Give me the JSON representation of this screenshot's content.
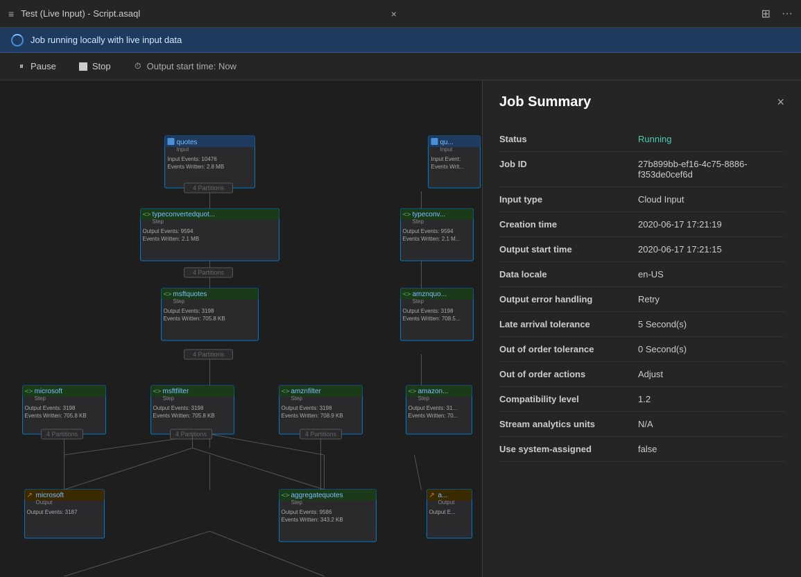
{
  "titleBar": {
    "menuIcon": "≡",
    "title": "Test (Live Input) - Script.asaql",
    "closeIcon": "×",
    "layoutIcon": "⊞",
    "moreIcon": "···"
  },
  "statusBar": {
    "message": "Job running locally with live input data"
  },
  "toolbar": {
    "pauseLabel": "Pause",
    "stopLabel": "Stop",
    "outputStartLabel": "Output start time: Now"
  },
  "jobSummary": {
    "title": "Job Summary",
    "closeIcon": "×",
    "rows": [
      {
        "label": "Status",
        "value": "Running",
        "isStatus": true
      },
      {
        "label": "Job ID",
        "value": "27b899bb-ef16-4c75-8886-f353de0cef6d"
      },
      {
        "label": "Input type",
        "value": "Cloud Input"
      },
      {
        "label": "Creation time",
        "value": "2020-06-17 17:21:19"
      },
      {
        "label": "Output start time",
        "value": "2020-06-17 17:21:15"
      },
      {
        "label": "Data locale",
        "value": "en-US"
      },
      {
        "label": "Output error handling",
        "value": "Retry"
      },
      {
        "label": "Late arrival tolerance",
        "value": "5 Second(s)"
      },
      {
        "label": "Out of order tolerance",
        "value": "0 Second(s)"
      },
      {
        "label": "Out of order actions",
        "value": "Adjust"
      },
      {
        "label": "Compatibility level",
        "value": "1.2"
      },
      {
        "label": "Stream analytics units",
        "value": "N/A"
      },
      {
        "label": "Use system-assigned",
        "value": "false"
      }
    ]
  },
  "diagramNodes": {
    "quotes": {
      "name": "quotes",
      "type": "Input",
      "events": "10476",
      "written": "2.8 MB",
      "partitions": "4 Partitions"
    },
    "quotes2": {
      "name": "qu...",
      "type": "Input",
      "events": "",
      "written": ""
    },
    "typeconverted": {
      "name": "typeconvertedquot...",
      "type": "Step",
      "events": "9594",
      "written": "2.1 MB",
      "partitions": "4 Partitions"
    },
    "typeconv2": {
      "name": "typeconv...",
      "type": "Step",
      "events": "9594",
      "written": "2.1 M..."
    },
    "msftquotes": {
      "name": "msftquotes",
      "type": "Step",
      "events": "3198",
      "written": "705.8 KB",
      "partitions": "4 Partitions"
    },
    "amznquotes": {
      "name": "amznquo...",
      "type": "Step",
      "events": "3198",
      "written": "708.5..."
    },
    "microsoft": {
      "name": "microsoft",
      "type": "Step",
      "events": "3198",
      "written": "705.8 KB",
      "partitions": "4 Partitions"
    },
    "msftfilter": {
      "name": "msftfilter",
      "type": "Step",
      "events": "3198",
      "written": "705.8 KB",
      "partitions": "4 Partitions"
    },
    "amznfilter": {
      "name": "amznfilter",
      "type": "Step",
      "events": "3198",
      "written": "708.9 KB",
      "partitions": "4 Partitions"
    },
    "amazon": {
      "name": "amazon...",
      "type": "Step",
      "events": "31...",
      "written": "70..."
    },
    "microsoftOut": {
      "name": "microsoft",
      "type": "Output",
      "events": "3187",
      "written": ""
    },
    "aggregatequotes": {
      "name": "aggregatequotes",
      "type": "Step",
      "events": "9586",
      "written": "343.2 KB"
    },
    "aOut": {
      "name": "a...",
      "type": "Output",
      "events": ""
    }
  }
}
